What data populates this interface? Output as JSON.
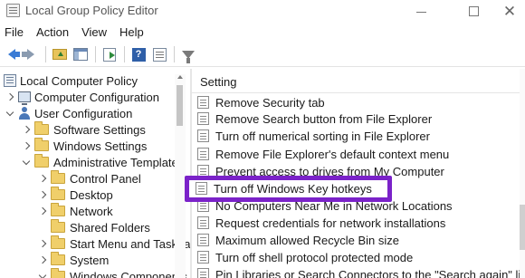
{
  "window": {
    "title": "Local Group Policy Editor",
    "controls": {
      "minimize": "minimize",
      "maximize": "maximize",
      "close": "✕"
    }
  },
  "menu": [
    "File",
    "Action",
    "View",
    "Help"
  ],
  "toolbar": {
    "icons": [
      "back-arrow-icon",
      "forward-arrow-icon",
      "up-folder-icon",
      "show-hide-pane-icon",
      "export-list-icon",
      "help-icon",
      "properties-icon",
      "filter-icon"
    ]
  },
  "tree": {
    "root": "Local Computer Policy",
    "items": [
      {
        "label": "Computer Configuration",
        "expanded": false
      },
      {
        "label": "User Configuration",
        "expanded": true
      },
      {
        "label": "Software Settings",
        "expanded": false
      },
      {
        "label": "Windows Settings",
        "expanded": false
      },
      {
        "label": "Administrative Templates",
        "expanded": true
      },
      {
        "label": "Control Panel",
        "expanded": false
      },
      {
        "label": "Desktop",
        "expanded": false
      },
      {
        "label": "Network",
        "expanded": false
      },
      {
        "label": "Shared Folders",
        "expanded": false
      },
      {
        "label": "Start Menu and Taskbar",
        "expanded": false
      },
      {
        "label": "System",
        "expanded": false
      },
      {
        "label": "Windows Components",
        "expanded": true
      }
    ]
  },
  "settings_list": {
    "header": "Setting",
    "items": [
      "Remove Security tab",
      "Remove Search button from File Explorer",
      "Turn off numerical sorting in File Explorer",
      "Remove File Explorer's default context menu",
      "Prevent access to drives from My Computer",
      "Turn off Windows Key hotkeys",
      "No Computers Near Me in Network Locations",
      "Request credentials for network installations",
      "Maximum allowed Recycle Bin size",
      "Turn off shell protocol protected mode",
      "Pin Libraries or Search Connectors to the \"Search again\" links"
    ],
    "highlighted": "Turn off Windows Key hotkeys",
    "highlight_color": "#7b22c9"
  }
}
